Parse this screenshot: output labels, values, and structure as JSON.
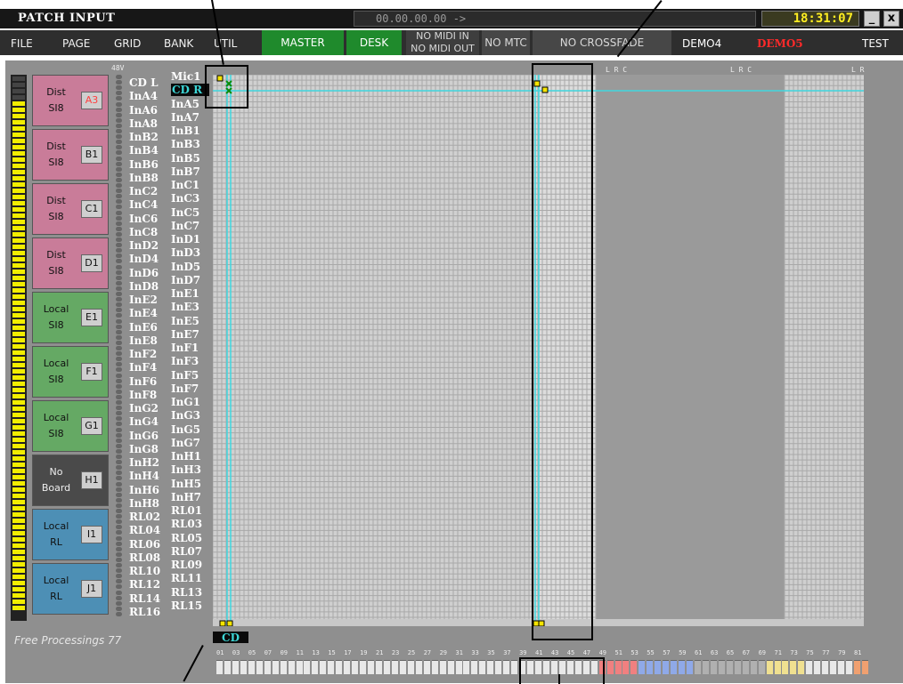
{
  "window": {
    "title": "PATCH INPUT",
    "timecode": "00.00.00.00  ->",
    "clock": "18:31:07",
    "minimize_label": "_",
    "close_label": "x"
  },
  "menu": [
    "FILE",
    "PAGE",
    "GRID",
    "BANK",
    "UTIL"
  ],
  "toolbar": {
    "master": "MASTER",
    "desk": "DESK",
    "midi_in": "NO MIDI IN",
    "midi_out": "NO MIDI OUT",
    "mtc": "NO MTC",
    "crossfade": "NO CROSSFADE",
    "scenes": [
      {
        "label": "DEMO4",
        "color": "#ffffff"
      },
      {
        "label": "DEMO5",
        "color": "#ff2a2a"
      },
      {
        "label": "TEST",
        "color": "#ffffff"
      }
    ]
  },
  "meter_label": "48V",
  "boards": [
    {
      "line1": "Dist",
      "line2": "SI8",
      "id": "A3",
      "id_color": "#ff4040",
      "color": "#c97c99"
    },
    {
      "line1": "Dist",
      "line2": "SI8",
      "id": "B1",
      "id_color": "#111111",
      "color": "#c97c99"
    },
    {
      "line1": "Dist",
      "line2": "SI8",
      "id": "C1",
      "id_color": "#111111",
      "color": "#c97c99"
    },
    {
      "line1": "Dist",
      "line2": "SI8",
      "id": "D1",
      "id_color": "#111111",
      "color": "#c97c99"
    },
    {
      "line1": "Local",
      "line2": "SI8",
      "id": "E1",
      "id_color": "#111111",
      "color": "#65a964"
    },
    {
      "line1": "Local",
      "line2": "SI8",
      "id": "F1",
      "id_color": "#111111",
      "color": "#65a964"
    },
    {
      "line1": "Local",
      "line2": "SI8",
      "id": "G1",
      "id_color": "#111111",
      "color": "#65a964"
    },
    {
      "line1": "No",
      "line2": "Board",
      "id": "H1",
      "id_color": "#111111",
      "color": "#4a4a4a"
    },
    {
      "line1": "Local",
      "line2": "RL",
      "id": "I1",
      "id_color": "#111111",
      "color": "#4d8fb5"
    },
    {
      "line1": "Local",
      "line2": "RL",
      "id": "J1",
      "id_color": "#111111",
      "color": "#4d8fb5"
    }
  ],
  "channels_col1": [
    "CD L",
    "InA4",
    "InA6",
    "InA8",
    "InB2",
    "InB4",
    "InB6",
    "InB8",
    "InC2",
    "InC4",
    "InC6",
    "InC8",
    "InD2",
    "InD4",
    "InD6",
    "InD8",
    "InE2",
    "InE4",
    "InE6",
    "InE8",
    "InF2",
    "InF4",
    "InF6",
    "InF8",
    "InG2",
    "InG4",
    "InG6",
    "InG8",
    "InH2",
    "InH4",
    "InH6",
    "InH8",
    "RL02",
    "RL04",
    "RL06",
    "RL08",
    "RL10",
    "RL12",
    "RL14",
    "RL16"
  ],
  "channels_col2": [
    "Mic1",
    "CD R",
    "InA5",
    "InA7",
    "InB1",
    "InB3",
    "InB5",
    "InB7",
    "InC1",
    "InC3",
    "InC5",
    "InC7",
    "InD1",
    "InD3",
    "InD5",
    "InD7",
    "InE1",
    "InE3",
    "InE5",
    "InE7",
    "InF1",
    "InF3",
    "InF5",
    "InF7",
    "InG1",
    "InG3",
    "InG5",
    "InG7",
    "InH1",
    "InH3",
    "InH5",
    "InH7",
    "RL01",
    "RL03",
    "RL05",
    "RL07",
    "RL09",
    "RL11",
    "RL13",
    "RL15"
  ],
  "selected_channel": "CD R",
  "bus_markers": [
    "L R C",
    "L R C",
    "L R"
  ],
  "free_processings": "Free Processings 77",
  "cd_tag": "CD",
  "output_numbers": [
    "01",
    "03",
    "05",
    "07",
    "09",
    "11",
    "13",
    "15",
    "17",
    "19",
    "21",
    "23",
    "25",
    "27",
    "29",
    "31",
    "33",
    "35",
    "37",
    "39",
    "41",
    "43",
    "45",
    "47",
    "49",
    "51",
    "53",
    "55",
    "57",
    "59",
    "61",
    "63",
    "65",
    "67",
    "69",
    "71",
    "73",
    "75",
    "77",
    "79",
    "81"
  ],
  "colors": {
    "title_bg": "#171717",
    "menu_bg": "#2e2e2e",
    "master_green": "#1f8a2c",
    "panel_bg": "#8f8f8f",
    "grid_cell": "#d4d4d4",
    "highlight_line": "#3fd8e0",
    "meter_yellow": "#f2ee00"
  }
}
